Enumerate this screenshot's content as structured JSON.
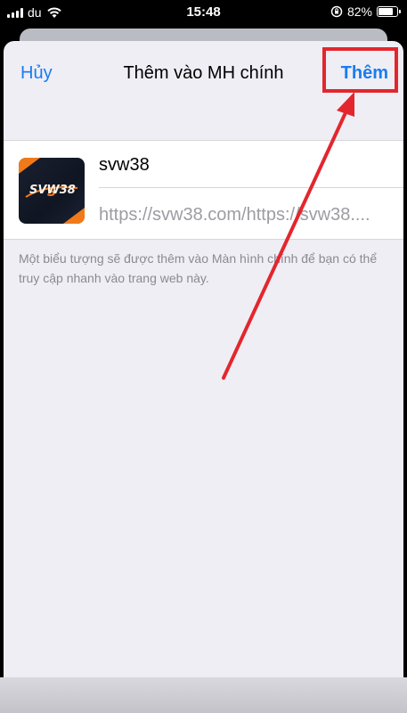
{
  "status_bar": {
    "carrier": "du",
    "time": "15:48",
    "battery": "82%",
    "battery_level": 0.82,
    "icons": [
      "signal-icon",
      "wifi-icon",
      "lock-rotation-icon",
      "battery-icon"
    ]
  },
  "nav": {
    "cancel_label": "Hủy",
    "title": "Thêm vào MH chính",
    "add_label": "Thêm"
  },
  "bookmark": {
    "name": "svw38",
    "url": "https://svw38.com/https://svw38....",
    "icon_text": "SVW38"
  },
  "description": "Một biểu tượng sẽ được thêm vào Màn hình chính để bạn có thể truy cập nhanh vào trang web này.",
  "colors": {
    "accent": "#1a7cf0",
    "annotation": "#e3262d",
    "sheet_bg": "#efeef4",
    "icon_orange": "#f07a1a"
  }
}
